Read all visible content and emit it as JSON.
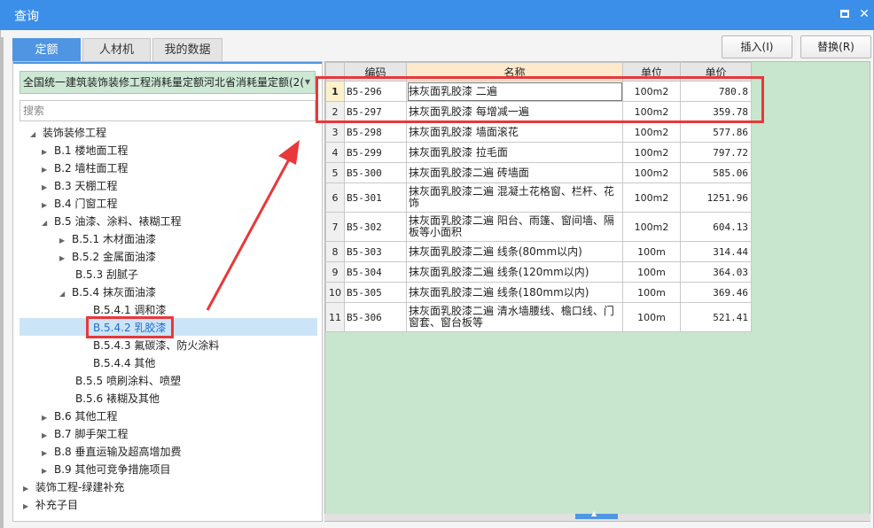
{
  "window": {
    "title": "查询"
  },
  "tabs": [
    {
      "label": "定额",
      "active": true
    },
    {
      "label": "人材机",
      "active": false
    },
    {
      "label": "我的数据",
      "active": false
    }
  ],
  "toolbar": {
    "insert_label": "插入(I)",
    "replace_label": "替换(R)"
  },
  "left": {
    "dropdown_value": "全国统一建筑装饰装修工程消耗量定额河北省消耗量定额(2(",
    "search_placeholder": "搜索",
    "tree": [
      {
        "label": "装饰装修工程",
        "arrow": "◢"
      },
      {
        "label": "B.1 楼地面工程",
        "arrow": "▶"
      },
      {
        "label": "B.2 墙柱面工程",
        "arrow": "▶"
      },
      {
        "label": "B.3 天棚工程",
        "arrow": "▶"
      },
      {
        "label": "B.4 门窗工程",
        "arrow": "▶"
      },
      {
        "label": "B.5 油漆、涂料、裱糊工程",
        "arrow": "◢"
      },
      {
        "label": "B.5.1 木材面油漆",
        "arrow": "▶"
      },
      {
        "label": "B.5.2 金属面油漆",
        "arrow": "▶"
      },
      {
        "label": "B.5.3 刮腻子",
        "arrow": ""
      },
      {
        "label": "B.5.4 抹灰面油漆",
        "arrow": "◢"
      },
      {
        "label": "B.5.4.1 调和漆",
        "arrow": ""
      },
      {
        "label": "B.5.4.2 乳胶漆",
        "arrow": "",
        "selected": true
      },
      {
        "label": "B.5.4.3 氟碳漆、防火涂料",
        "arrow": ""
      },
      {
        "label": "B.5.4.4 其他",
        "arrow": ""
      },
      {
        "label": "B.5.5 喷刷涂料、喷塑",
        "arrow": ""
      },
      {
        "label": "B.5.6 裱糊及其他",
        "arrow": ""
      },
      {
        "label": "B.6 其他工程",
        "arrow": "▶"
      },
      {
        "label": "B.7 脚手架工程",
        "arrow": "▶"
      },
      {
        "label": "B.8 垂直运输及超高增加费",
        "arrow": "▶"
      },
      {
        "label": "B.9 其他可竞争措施项目",
        "arrow": "▶"
      },
      {
        "label": "装饰工程-绿建补充",
        "arrow": "▶"
      },
      {
        "label": "补充子目",
        "arrow": "▶"
      }
    ]
  },
  "grid": {
    "headers": [
      "编码",
      "名称",
      "单位",
      "单价"
    ],
    "rows": [
      {
        "idx": "1",
        "code": "B5-296",
        "name": "抹灰面乳胶漆 二遍",
        "unit": "100m2",
        "price": "780.8"
      },
      {
        "idx": "2",
        "code": "B5-297",
        "name": "抹灰面乳胶漆 每增减一遍",
        "unit": "100m2",
        "price": "359.78"
      },
      {
        "idx": "3",
        "code": "B5-298",
        "name": "抹灰面乳胶漆 墙面滚花",
        "unit": "100m2",
        "price": "577.86"
      },
      {
        "idx": "4",
        "code": "B5-299",
        "name": "抹灰面乳胶漆 拉毛面",
        "unit": "100m2",
        "price": "797.72"
      },
      {
        "idx": "5",
        "code": "B5-300",
        "name": "抹灰面乳胶漆二遍 砖墙面",
        "unit": "100m2",
        "price": "585.06"
      },
      {
        "idx": "6",
        "code": "B5-301",
        "name": "抹灰面乳胶漆二遍 混凝土花格窗、栏杆、花饰",
        "unit": "100m2",
        "price": "1251.96"
      },
      {
        "idx": "7",
        "code": "B5-302",
        "name": "抹灰面乳胶漆二遍 阳台、雨篷、窗间墙、隔板等小面积",
        "unit": "100m2",
        "price": "604.13"
      },
      {
        "idx": "8",
        "code": "B5-303",
        "name": "抹灰面乳胶漆二遍 线条(80mm以内)",
        "unit": "100m",
        "price": "314.44"
      },
      {
        "idx": "9",
        "code": "B5-304",
        "name": "抹灰面乳胶漆二遍 线条(120mm以内)",
        "unit": "100m",
        "price": "364.03"
      },
      {
        "idx": "10",
        "code": "B5-305",
        "name": "抹灰面乳胶漆二遍 线条(180mm以内)",
        "unit": "100m",
        "price": "369.46"
      },
      {
        "idx": "11",
        "code": "B5-306",
        "name": "抹灰面乳胶漆二遍 清水墙腰线、檐口线、门窗套、窗台板等",
        "unit": "100m",
        "price": "521.41"
      }
    ]
  },
  "colors": {
    "titlebar": "#3c8fe8",
    "active_tab": "#4f95e2",
    "annotation": "#e8383a",
    "grid_bg": "#c8e6cd"
  }
}
